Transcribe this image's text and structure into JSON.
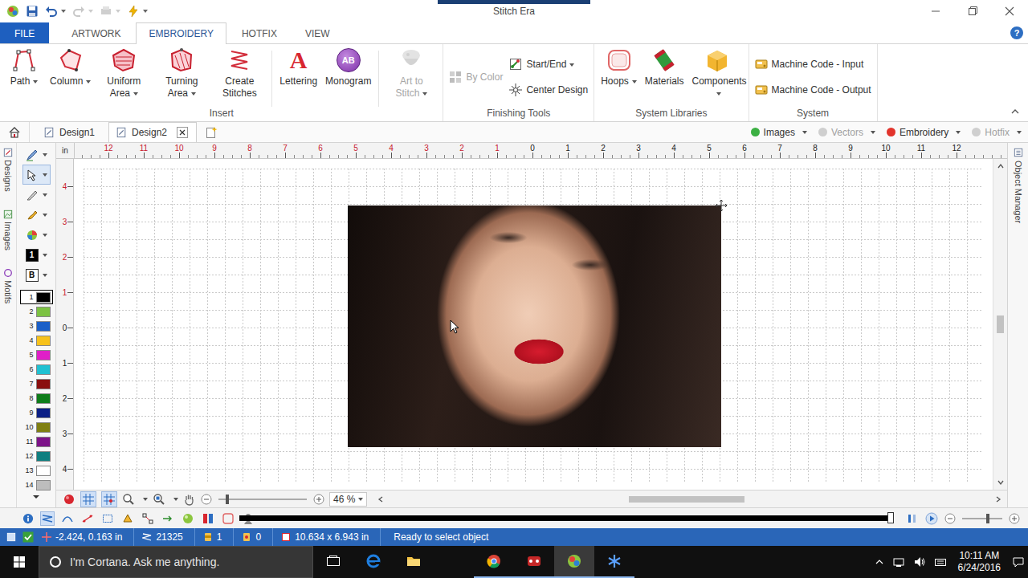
{
  "window": {
    "title": "Stitch Era"
  },
  "ribbon": {
    "tabs": [
      {
        "label": "FILE",
        "kind": "file",
        "selected": false
      },
      {
        "label": "ARTWORK",
        "kind": "tab",
        "selected": false
      },
      {
        "label": "EMBROIDERY",
        "kind": "tab",
        "selected": true
      },
      {
        "label": "HOTFIX",
        "kind": "tab",
        "selected": false
      },
      {
        "label": "VIEW",
        "kind": "tab",
        "selected": false
      }
    ],
    "help": "?",
    "groups": [
      {
        "label": "Insert",
        "sections": [
          {
            "kind": "large",
            "divided": true,
            "buttons": [
              {
                "label": "Path",
                "kind": "path",
                "glyph": "",
                "dropdown": true,
                "disabled": false
              },
              {
                "label": "Column",
                "kind": "column",
                "glyph": "",
                "dropdown": true,
                "disabled": false
              },
              {
                "label": "Uniform Area",
                "kind": "uniform",
                "glyph": "",
                "dropdown": true,
                "disabled": false
              },
              {
                "label": "Turning Area",
                "kind": "turning",
                "glyph": "",
                "dropdown": true,
                "disabled": false
              },
              {
                "label": "Create Stitches",
                "kind": "stitches",
                "glyph": "",
                "dropdown": false,
                "disabled": false
              }
            ]
          },
          {
            "kind": "large",
            "divided": true,
            "buttons": [
              {
                "label": "Lettering",
                "kind": "lettering",
                "glyph": "A",
                "dropdown": false,
                "disabled": false
              },
              {
                "label": "Monogram",
                "kind": "monogram",
                "glyph": "AB",
                "dropdown": false,
                "disabled": false
              }
            ]
          },
          {
            "kind": "large",
            "divided": false,
            "buttons": [
              {
                "label": "Art to Stitch",
                "kind": "art",
                "glyph": "",
                "dropdown": true,
                "disabled": true
              }
            ]
          }
        ]
      },
      {
        "label": "Finishing Tools",
        "sections": [
          {
            "kind": "small",
            "divided": false,
            "buttons": [
              {
                "label": "By Color",
                "kind": "bycolor",
                "glyph": "",
                "dropdown": false,
                "disabled": true
              }
            ]
          },
          {
            "kind": "small",
            "divided": false,
            "buttons": [
              {
                "label": "Start/End",
                "kind": "startend",
                "glyph": "",
                "dropdown": true,
                "disabled": false
              },
              {
                "label": "Center Design",
                "kind": "center",
                "glyph": "",
                "dropdown": false,
                "disabled": false
              }
            ]
          }
        ]
      },
      {
        "label": "System Libraries",
        "sections": [
          {
            "kind": "large",
            "divided": false,
            "buttons": [
              {
                "label": "Hoops",
                "kind": "hoops",
                "glyph": "",
                "dropdown": true,
                "disabled": false
              },
              {
                "label": "Materials",
                "kind": "materials",
                "glyph": "",
                "dropdown": false,
                "disabled": false
              },
              {
                "label": "Components",
                "kind": "components",
                "glyph": "",
                "dropdown": true,
                "disabled": false
              }
            ]
          }
        ]
      },
      {
        "label": "System",
        "sections": [
          {
            "kind": "small",
            "divided": false,
            "buttons": [
              {
                "label": "Machine Code - Input",
                "kind": "machine",
                "glyph": "",
                "dropdown": false,
                "disabled": false
              },
              {
                "label": "Machine Code - Output",
                "kind": "machine",
                "glyph": "",
                "dropdown": false,
                "disabled": false
              }
            ]
          }
        ]
      }
    ]
  },
  "documents": {
    "tabs": [
      {
        "label": "Design1",
        "selected": false,
        "closable": false
      },
      {
        "label": "Design2",
        "selected": true,
        "closable": true
      }
    ],
    "layers": [
      {
        "label": "Images",
        "on": true,
        "color": "#3cb043"
      },
      {
        "label": "Vectors",
        "on": false,
        "color": "#cfcfcf"
      },
      {
        "label": "Embroidery",
        "on": true,
        "color": "#e2342c"
      },
      {
        "label": "Hotfix",
        "on": false,
        "color": "#cfcfcf"
      }
    ]
  },
  "side_tabs": [
    {
      "label": "Designs",
      "kind": "designs"
    },
    {
      "label": "Images",
      "kind": "images"
    },
    {
      "label": "Motifs",
      "kind": "motifs"
    }
  ],
  "color_selectors": {
    "foreground": "1",
    "background": "B"
  },
  "palette": [
    {
      "number": "1",
      "color": "#000000",
      "selected": true
    },
    {
      "number": "2",
      "color": "#7cc242",
      "selected": false
    },
    {
      "number": "3",
      "color": "#1a5fc8",
      "selected": false
    },
    {
      "number": "4",
      "color": "#f7c21b",
      "selected": false
    },
    {
      "number": "5",
      "color": "#e01fc8",
      "selected": false
    },
    {
      "number": "6",
      "color": "#1fc1d2",
      "selected": false
    },
    {
      "number": "7",
      "color": "#8a0f0f",
      "selected": false
    },
    {
      "number": "8",
      "color": "#0e7d1a",
      "selected": false
    },
    {
      "number": "9",
      "color": "#0b1f86",
      "selected": false
    },
    {
      "number": "10",
      "color": "#7f7f12",
      "selected": false
    },
    {
      "number": "11",
      "color": "#7d1389",
      "selected": false
    },
    {
      "number": "12",
      "color": "#0f7f80",
      "selected": false
    },
    {
      "number": "13",
      "color": "#ffffff",
      "selected": false
    },
    {
      "number": "14",
      "color": "#bdbdbd",
      "selected": false
    }
  ],
  "ruler": {
    "unit": "in",
    "horizontal_negative": [
      "12",
      "11",
      "10",
      "9",
      "8",
      "7",
      "6",
      "5",
      "4",
      "3",
      "2",
      "1"
    ],
    "horizontal_positive": [
      "0",
      "1",
      "2",
      "3",
      "4",
      "5",
      "6",
      "7",
      "8",
      "9",
      "10",
      "11",
      "12"
    ],
    "vertical_negative": [
      "4",
      "3",
      "2",
      "1"
    ],
    "vertical_positive": [
      "0",
      "1",
      "2",
      "3",
      "4"
    ]
  },
  "right_panel": {
    "label": "Object Manager"
  },
  "zoom": {
    "value": "46 %",
    "level": 0.08
  },
  "scroll": {
    "horizontal": {
      "start": 0.4,
      "size": 0.19
    },
    "vertical": {
      "start": 0.47,
      "size": 0.06
    }
  },
  "stitch_player": {
    "level": 1
  },
  "status_bar": [
    {
      "text": "-2.424, 0.163 in",
      "kind": "cursor"
    },
    {
      "text": "21325",
      "kind": "stitches"
    },
    {
      "text": "1",
      "kind": "colors"
    },
    {
      "text": "0",
      "kind": "stops"
    },
    {
      "text": "10.634 x 6.943 in",
      "kind": "size"
    },
    {
      "text": "Ready to select object",
      "kind": "message"
    }
  ],
  "taskbar": {
    "search": {
      "placeholder": "I'm Cortana. Ask me anything."
    },
    "apps": [
      {
        "kind": "taskview",
        "running": false,
        "active": false
      },
      {
        "kind": "edge",
        "running": false,
        "active": false
      },
      {
        "kind": "explorer",
        "running": false,
        "active": false
      },
      {
        "kind": "chrome",
        "running": true,
        "active": false
      },
      {
        "kind": "game",
        "running": true,
        "active": false
      },
      {
        "kind": "stitchera",
        "running": true,
        "active": true
      },
      {
        "kind": "snowflake",
        "running": true,
        "active": false
      }
    ],
    "clock": {
      "time": "10:11 AM",
      "date": "6/24/2016"
    }
  }
}
